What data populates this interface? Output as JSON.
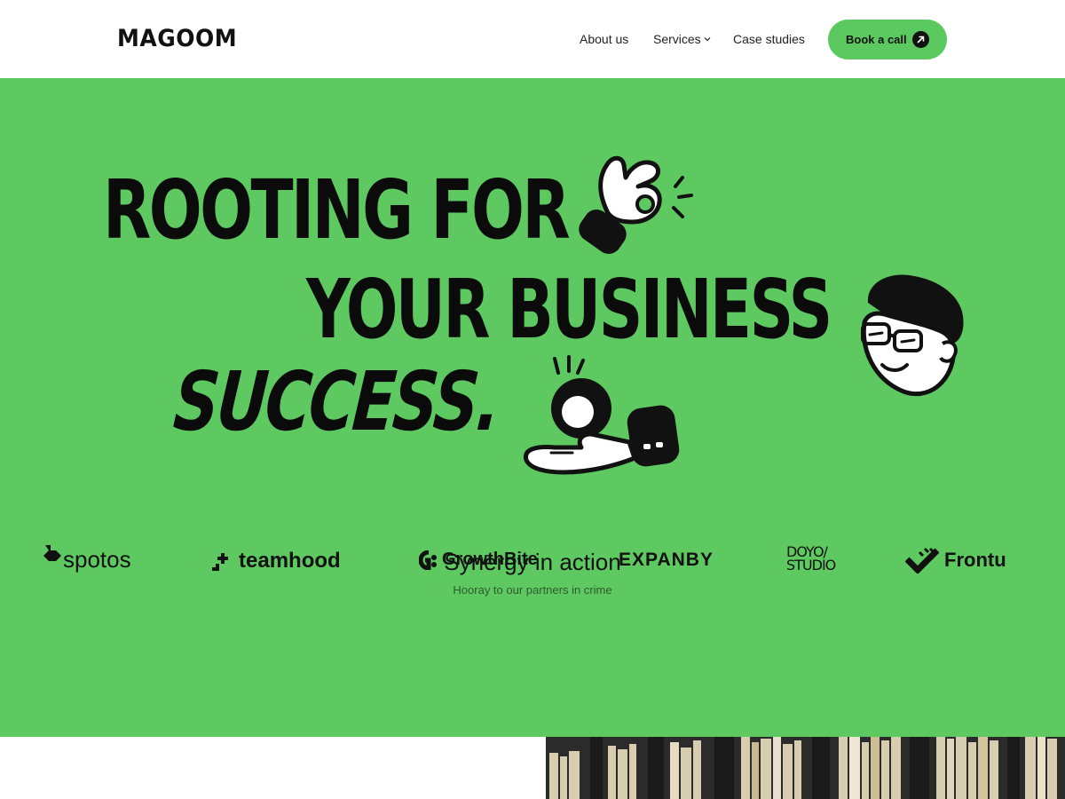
{
  "header": {
    "logo": "MAGOOM",
    "nav": [
      {
        "label": "About us"
      },
      {
        "label": "Services"
      },
      {
        "label": "Case studies"
      }
    ],
    "cta_label": "Book a call"
  },
  "hero": {
    "line1": "ROOTING FOR",
    "line2": "YOUR BUSINESS",
    "line3": "SUCCESS."
  },
  "partners_section": {
    "title": "Synergy in action",
    "subtitle": "Hooray to our partners in crime",
    "partners": [
      {
        "name": "spotos",
        "icon": "spotos-logo-icon"
      },
      {
        "name": "teamhood",
        "icon": "teamhood-logo-icon"
      },
      {
        "name": "GrowthBite",
        "icon": "growthbite-logo-icon"
      },
      {
        "name": "EXPANBY",
        "icon": "expanby-logo"
      },
      {
        "name_line1": "DOYO/",
        "name_line2": "STUDIO"
      },
      {
        "name": "Frontu",
        "icon": "frontu-logo-icon"
      }
    ]
  },
  "colors": {
    "brand_green": "#5ec961",
    "button_green": "#5bc95f",
    "ink": "#111111"
  }
}
